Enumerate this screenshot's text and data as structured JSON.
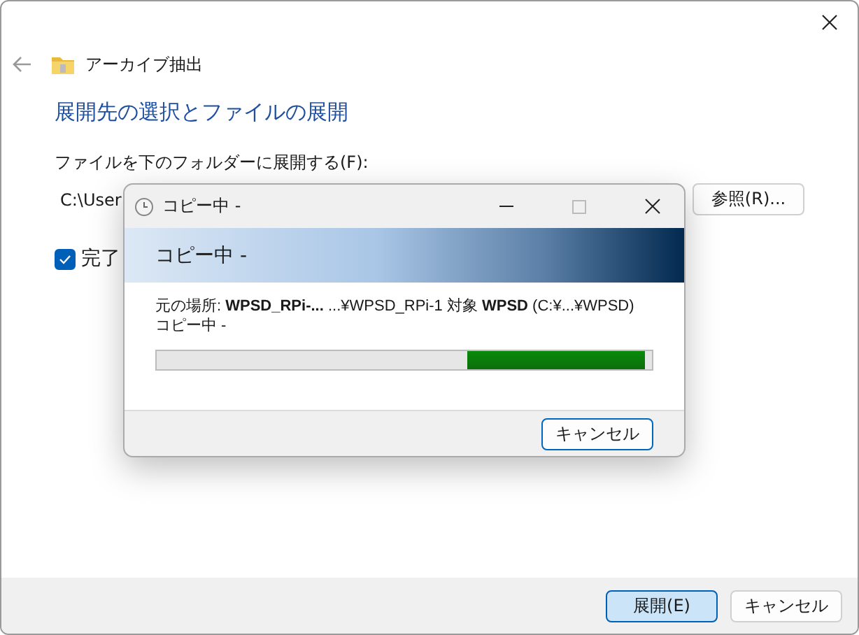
{
  "window": {
    "title": "アーカイブ抽出",
    "heading": "展開先の選択とファイルの展開",
    "folder_label": "ファイルを下のフォルダーに展開する(F):",
    "folder_path": "C:\\User",
    "browse_button": "参照(R)...",
    "show_checkbox": {
      "label": "完了",
      "checked": true
    },
    "buttons": [
      {
        "label": "展開(E)",
        "selected": true
      },
      {
        "label": "キャンセル",
        "selected": false
      }
    ]
  },
  "dialog": {
    "title": "コピー中 -",
    "banner": "コピー中 -",
    "source_line": "元の場所: **WPSD_RPi-...**   ...¥WPSD_RPi-1 対象 **WPSD** (C:¥...¥WPSD)",
    "status": "コピー中 -",
    "progress": {
      "level": 0.36
    },
    "cancel_button": "キャンセル"
  }
}
